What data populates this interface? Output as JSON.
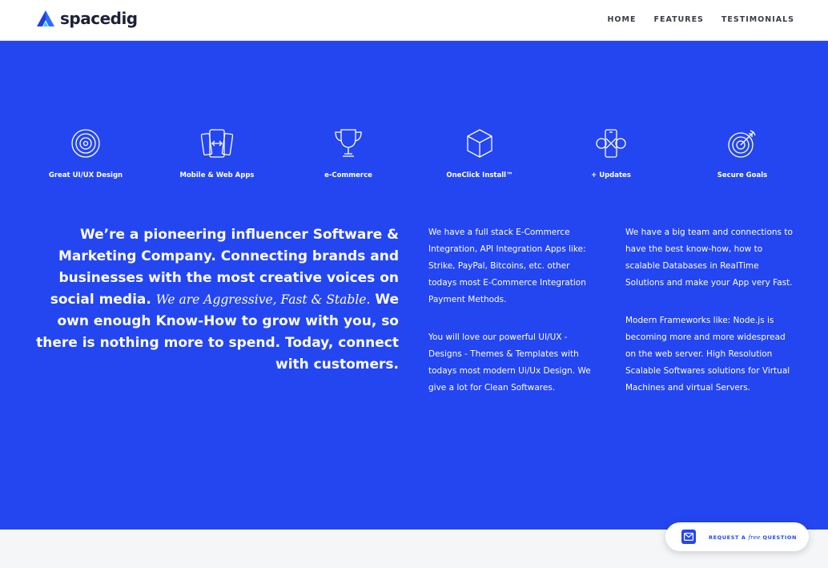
{
  "brand": {
    "name": "spacedig",
    "accent": "#2446f1"
  },
  "nav": {
    "items": [
      "HOME",
      "FEATURES",
      "TESTIMONIALS"
    ]
  },
  "features": {
    "items": [
      {
        "label": "Great UI/UX Design",
        "icon": "target-rings-icon"
      },
      {
        "label": "Mobile & Web Apps",
        "icon": "devices-icon"
      },
      {
        "label": "e-Commerce",
        "icon": "trophy-icon"
      },
      {
        "label": "OneClick Install™",
        "icon": "cube-icon"
      },
      {
        "label": "+ Updates",
        "icon": "phone-sync-icon"
      },
      {
        "label": "Secure Goals",
        "icon": "target-arrow-icon"
      }
    ]
  },
  "statement": {
    "part1": "We’re a pioneering influencer Software & Marketing Company. Connecting brands and businesses with the most creative voices on social media.",
    "emphasis": "We are Aggressive, Fast & Stable.",
    "part2": "We own enough Know-How to grow with you, so there is nothing more to spend. Today, connect with customers."
  },
  "columns": {
    "col1": [
      "We have a full stack E-Commerce Integration, API Integration Apps like: Strike, PayPal, Bitcoins, etc. other todays most E-Commerce Integration Payment Methods.",
      "You will love our powerful UI/UX - Designs - Themes & Templates with todays most modern Ui/Ux Design. We give a lot for Clean Softwares."
    ],
    "col2": [
      "We have a big team and connections to have the best know-how, how to scalable Databases in RealTime Solutions and make your App very Fast.",
      "Modern Frameworks like: Node.js is becoming more and more widespread on the web server. High Resolution Scalable Softwares solutions for Virtual Machines and virtual Servers."
    ]
  },
  "cta": {
    "prefix": "REQUEST A",
    "free": "free",
    "suffix": "QUESTION",
    "icon": "envelope-icon"
  }
}
